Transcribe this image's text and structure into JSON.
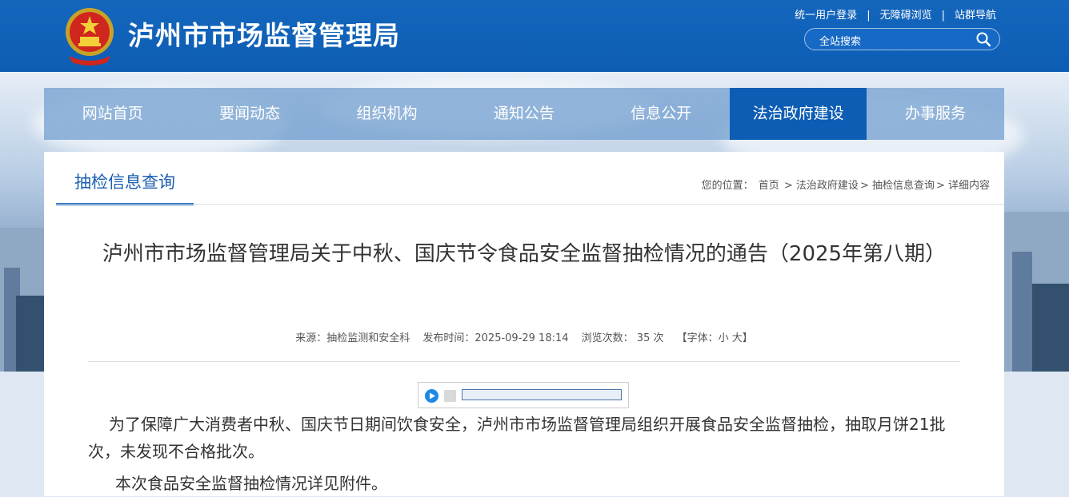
{
  "header": {
    "site_title": "泸州市市场监督管理局",
    "links": [
      "统一用户登录",
      "无障碍浏览",
      "站群导航"
    ],
    "search_placeholder": "全站搜索"
  },
  "nav": {
    "items": [
      "网站首页",
      "要闻动态",
      "组织机构",
      "通知公告",
      "信息公开",
      "法治政府建设",
      "办事服务"
    ],
    "active": "法治政府建设"
  },
  "section": {
    "tab_label": "抽检信息查询",
    "breadcrumb": {
      "prefix": "您的位置：",
      "items": [
        "首页",
        "> 法治政府建设",
        "> 抽检信息查询",
        "> 详细内容"
      ]
    }
  },
  "article": {
    "title": "泸州市市场监督管理局关于中秋、国庆节令食品安全监督抽检情况的通告（2025年第八期）",
    "source": "来源：抽检监测和安全科",
    "publish_time": "发布时间：2025-09-29 18:14",
    "views": "浏览次数： 35  次",
    "font_size": "【字体：小 大】",
    "paragraphs": [
      "为了保障广大消费者中秋、国庆节日期间饮食安全，泸州市市场监督管理局组织开展食品安全监督抽检，抽取月饼21批次，未发现不合格批次。",
      "本次食品安全监督抽检情况详见附件。"
    ]
  },
  "colors": {
    "header_blue": "#0d5db4",
    "active_nav": "#0d5db4",
    "tab_text": "#1b5eb0"
  }
}
